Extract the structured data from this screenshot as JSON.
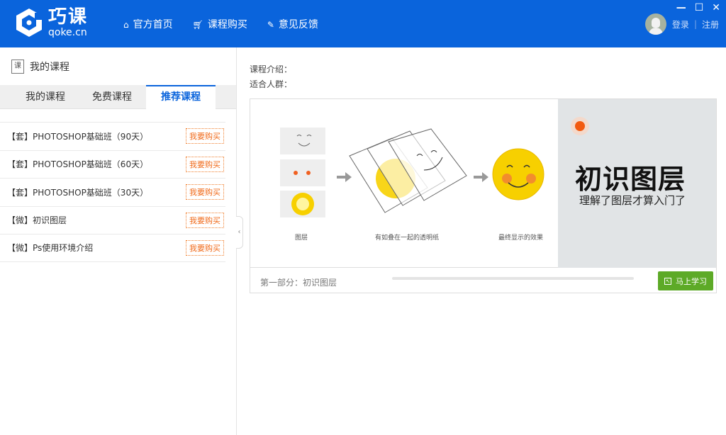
{
  "header": {
    "logo_title": "巧课",
    "logo_domain": "qoke.cn",
    "nav": [
      {
        "label": "官方首页",
        "icon": "home-icon"
      },
      {
        "label": "课程购买",
        "icon": "cart-icon"
      },
      {
        "label": "意见反馈",
        "icon": "pencil-icon"
      }
    ],
    "login": "登录",
    "separator": "|",
    "register": "注册",
    "window": {
      "minimize": "—",
      "maximize": "☐",
      "close": "✕"
    }
  },
  "left": {
    "title_icon": "课",
    "title": "我的课程",
    "tabs": [
      "我的课程",
      "免费课程",
      "推荐课程"
    ],
    "active_tab": 2,
    "courses": [
      {
        "name": "【套】PHOTOSHOP基础班（90天）",
        "action": "我要购买"
      },
      {
        "name": "【套】PHOTOSHOP基础班（60天）",
        "action": "我要购买"
      },
      {
        "name": "【套】PHOTOSHOP基础班（30天）",
        "action": "我要购买"
      },
      {
        "name": "【微】初识图层",
        "action": "我要购买"
      },
      {
        "name": "【微】Ps使用环境介绍",
        "action": "我要购买"
      }
    ],
    "collapse": "‹"
  },
  "main": {
    "intro_label": "课程介绍：",
    "audience_label": "适合人群：",
    "banner": {
      "title": "初识图层",
      "subtitle": "理解了图层才算入门了",
      "captions": [
        "图层",
        "有如叠在一起的透明纸",
        "最终显示的效果"
      ]
    },
    "section": "第一部分：初识图层",
    "progress": 0,
    "learn_button": "马上学习",
    "accent": "#0a64dc",
    "learn_color": "#5daa27"
  }
}
